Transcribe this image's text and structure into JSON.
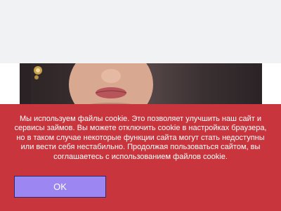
{
  "cookie_banner": {
    "message": "Мы используем файлы cookie. Это позволяет улучшить наш сайт и сервисы займов. Вы можете отключить cookie в настройках браузера, но в таком случае некоторые функции сайта могут стать недоступны или вести себя нестабильно. Продолжая пользоваться сайтом, вы соглашаетесь с использованием файлов cookie.",
    "ok_label": "OK"
  },
  "colors": {
    "banner_background": "#c9353c",
    "button_background": "#9b86f2",
    "button_border": "#2e2a6e",
    "top_bar": "#f1f2f4"
  }
}
